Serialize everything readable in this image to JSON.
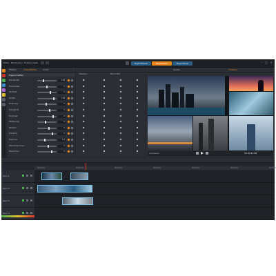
{
  "app": {
    "menu": [
      "Datei",
      "Bearbeiten",
      "Einstellungen"
    ],
    "modes": [
      "Organisieren",
      "Bearbeiten",
      "Exportieren"
    ],
    "active_mode": "Bearbeiten",
    "colors": {
      "accent": "#e8871e",
      "clip": "#7bc0e6",
      "playhead": "#d9342b",
      "mode_blue": "#2d5f86"
    }
  },
  "effects_panel": {
    "tabs": [
      "Effekte",
      "Videoeffekte",
      "Audio"
    ],
    "title": "Eigenschaften",
    "rows": [
      {
        "label": "Deckkraft",
        "value": "100"
      },
      {
        "label": "Horizontal",
        "value": "0"
      },
      {
        "label": "Vertikal",
        "value": "0"
      },
      {
        "label": "Größe",
        "value": "100"
      },
      {
        "label": "Drehung",
        "value": "0"
      },
      {
        "label": "Helligkeit",
        "value": "0"
      },
      {
        "label": "Kontrast",
        "value": "0"
      },
      {
        "label": "Sättigung",
        "value": "0"
      },
      {
        "label": "Farbton",
        "value": "0"
      },
      {
        "label": "Schärfe",
        "value": "0"
      },
      {
        "label": "Gamma",
        "value": "1.0"
      },
      {
        "label": "Weichzeichnen",
        "value": "0"
      },
      {
        "label": "Rauschen",
        "value": "0"
      }
    ]
  },
  "keyframes": {
    "columns": [
      "Videospur",
      "Bild-in-Bild"
    ]
  },
  "preview": {
    "tabs": [
      "Quelle",
      "Timeline"
    ],
    "timecode": "00:00:12:08",
    "zoom": "Anpassen"
  },
  "timeline": {
    "tracks": [
      "Spur 1",
      "Spur 2",
      "Spur 3",
      "Spur 4"
    ],
    "ruler": [
      "00:00:00",
      "00:00:10",
      "00:00:20",
      "00:00:30",
      "00:00:40",
      "00:00:50",
      "00:01:00"
    ]
  }
}
